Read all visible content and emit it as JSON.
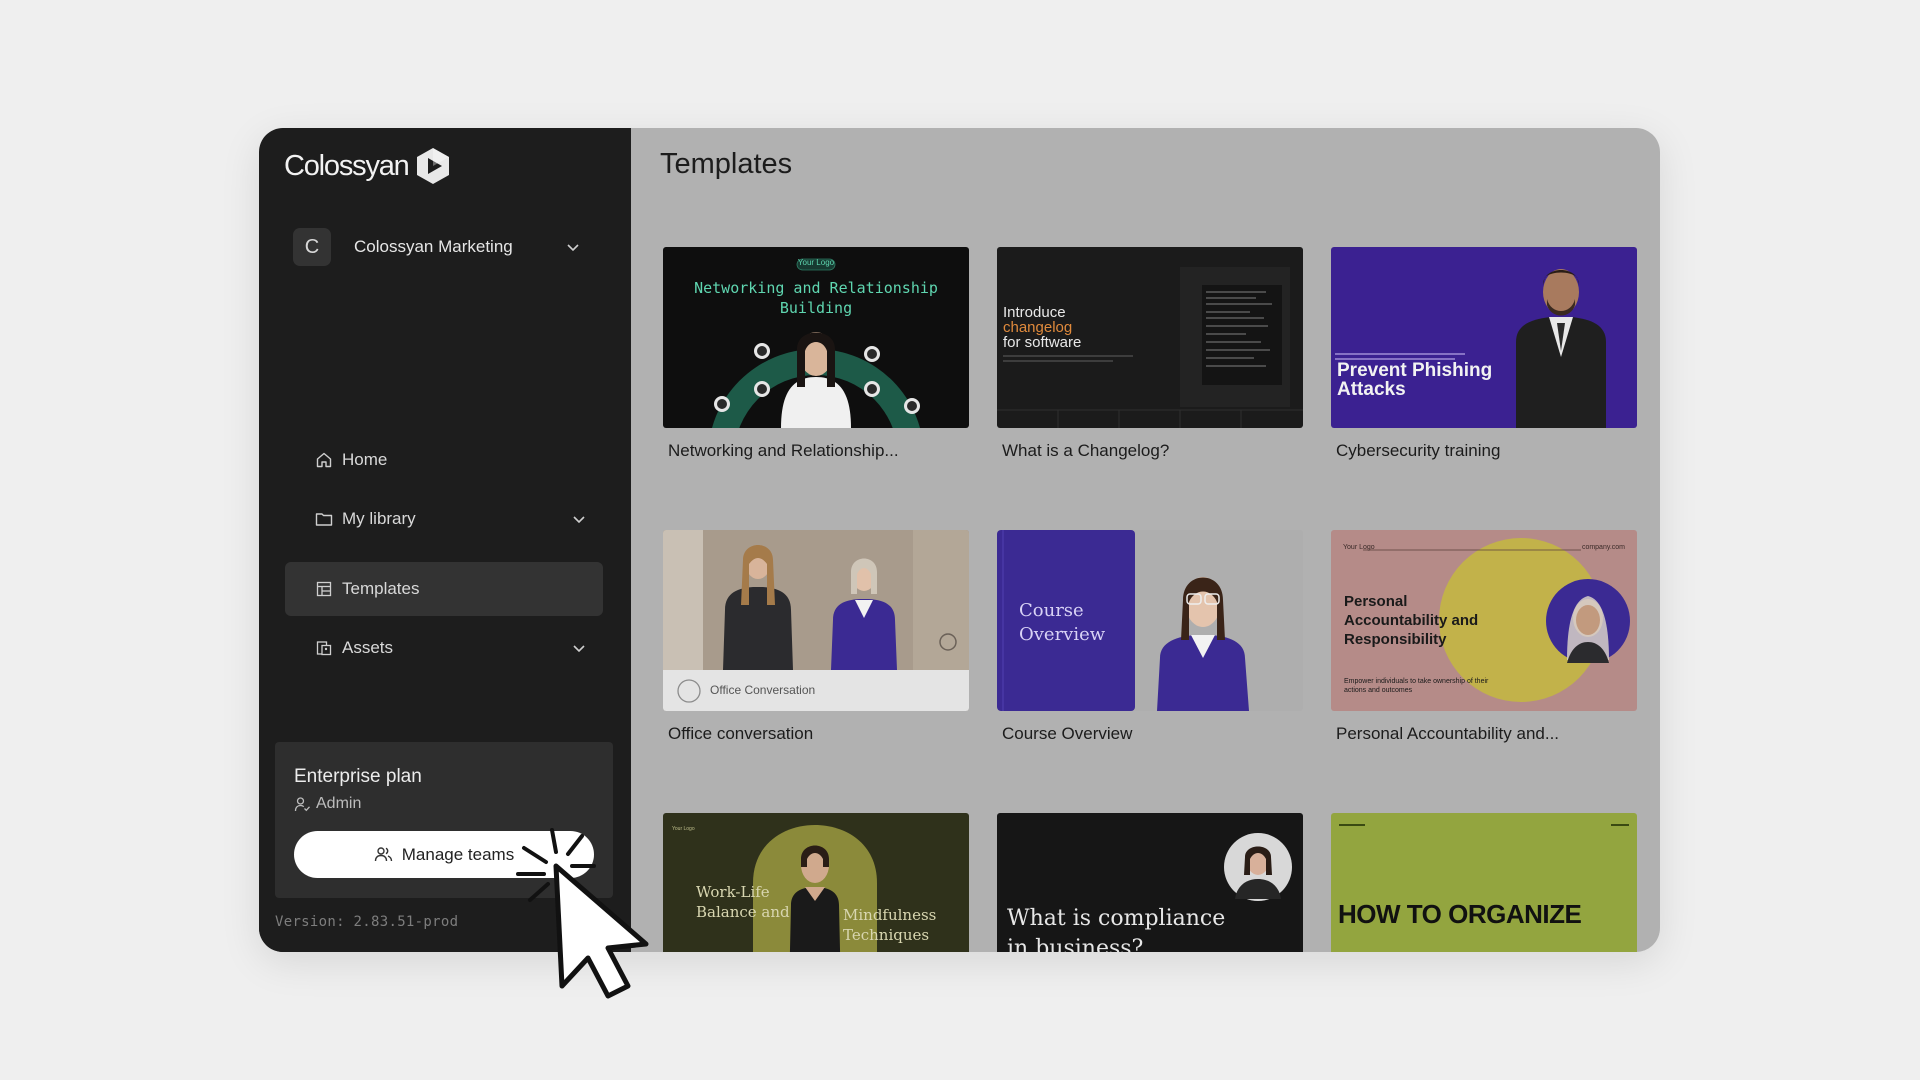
{
  "brand": {
    "name": "Colossyan",
    "logo_icon": "play-cube-logo"
  },
  "workspace": {
    "initial": "C",
    "name": "Colossyan Marketing"
  },
  "nav": {
    "items": [
      {
        "label": "Home",
        "icon": "home-icon"
      },
      {
        "label": "My library",
        "icon": "folder-icon"
      },
      {
        "label": "Templates",
        "icon": "templates-icon",
        "active": true
      },
      {
        "label": "Assets",
        "icon": "assets-icon"
      }
    ]
  },
  "plan": {
    "title": "Enterprise plan",
    "role": "Admin",
    "button": "Manage teams"
  },
  "version": "Version: 2.83.51-prod",
  "main": {
    "title": "Templates"
  },
  "templates": [
    {
      "title": "Networking and Relationship...",
      "thumb_heading": "Networking and Relationship Building",
      "thumb_chip": "Your Logo"
    },
    {
      "title": "What is a Changelog?",
      "thumb_line1": "Introduce",
      "thumb_line2": "changelog",
      "thumb_line3": "for software"
    },
    {
      "title": "Cybersecurity training",
      "thumb_heading": "Prevent Phishing Attacks"
    },
    {
      "title": "Office conversation",
      "thumb_caption": "Office Conversation"
    },
    {
      "title": "Course Overview",
      "thumb_heading": "Course Overview"
    },
    {
      "title": "Personal Accountability and...",
      "thumb_heading": "Personal Accountability and Responsibility",
      "thumb_sub": "Empower individuals to take ownership of their actions and outcomes",
      "thumb_url": "company.com",
      "thumb_logo": "Your Logo"
    },
    {
      "title": "",
      "thumb_left": "Work-Life Balance and",
      "thumb_right": "Mindfulness Techniques",
      "thumb_logo": "Your Logo"
    },
    {
      "title": "",
      "thumb_heading": "What is compliance in business?"
    },
    {
      "title": "",
      "thumb_heading": "HOW TO ORGANIZE"
    }
  ],
  "colors": {
    "sidebar": "#1d1d1d",
    "main": "#b1b1b1",
    "active_nav": "#333333",
    "accent_orange": "#e08a3c",
    "accent_teal": "#5fd6b0"
  }
}
